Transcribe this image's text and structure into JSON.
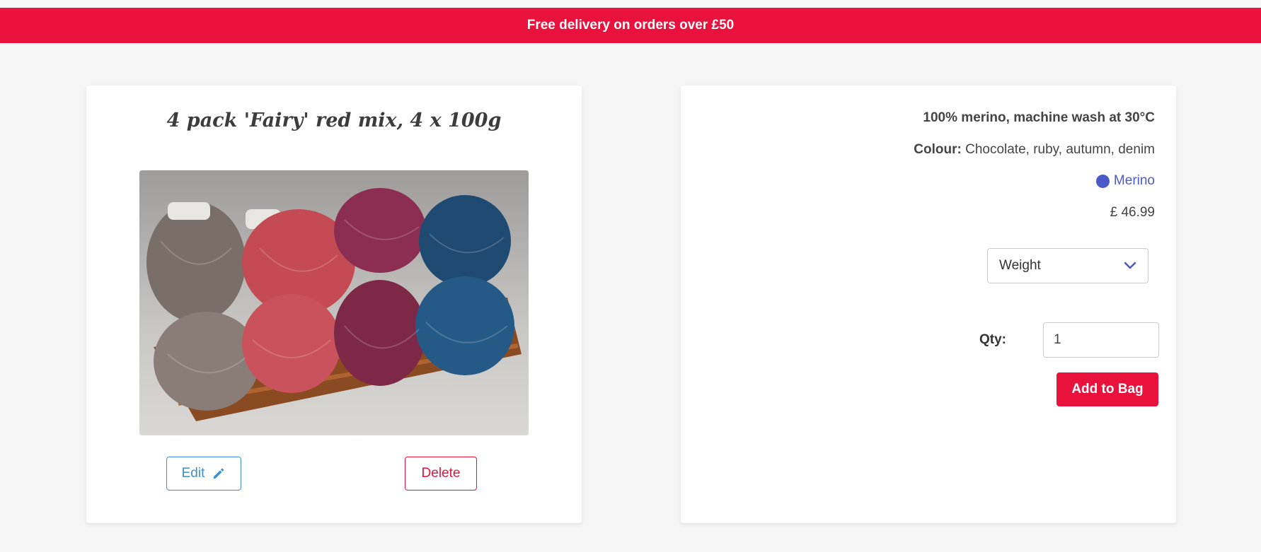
{
  "banner": {
    "text": "Free delivery on orders over £50"
  },
  "product": {
    "title": "4 pack 'Fairy' red mix, 4 x 100g",
    "image_icon": "yarn-skeins-photo",
    "edit_label": "Edit",
    "edit_icon": "pencil-icon",
    "delete_label": "Delete",
    "description": "100% merino, machine wash at 30°C",
    "colour_label": "Colour:",
    "colour_value": " Chocolate, ruby, autumn, denim",
    "category": "Merino",
    "category_color": "#4a5bc9",
    "price": "£ 46.99",
    "weight_select": {
      "selected": "Weight"
    },
    "qty_label": "Qty:",
    "qty_value": "1",
    "add_to_bag_label": "Add to Bag"
  },
  "colors": {
    "accent": "#e8123d",
    "edit_blue": "#3f8fd0"
  }
}
